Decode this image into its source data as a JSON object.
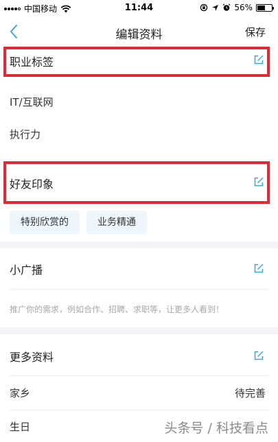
{
  "status_bar": {
    "carrier": "中国移动",
    "time": "11:44",
    "battery_percent": "56%",
    "battery_level": 0.56,
    "icons": [
      "signal-icon",
      "wifi-icon",
      "lock-rotation-icon",
      "location-icon",
      "alarm-icon",
      "battery-icon"
    ]
  },
  "nav": {
    "title": "编辑资料",
    "save_label": "保存",
    "back_icon": "chevron-left-icon"
  },
  "career_tags": {
    "title": "职业标签",
    "items": [
      "IT/互联网",
      "执行力"
    ]
  },
  "friend_impressions": {
    "title": "好友印象",
    "chips": [
      "特别欣赏的",
      "业务精通"
    ]
  },
  "broadcast": {
    "title": "小广播",
    "hint": "推广你的需求，例如合作、招聘、求职等，让更多人看到！"
  },
  "more_info": {
    "title": "更多资料",
    "rows": [
      {
        "label": "家乡",
        "value": "待完善"
      },
      {
        "label": "生日",
        "value": ""
      }
    ]
  },
  "watermark": "头条号 / 科技看点",
  "colors": {
    "accent": "#3aa6d8",
    "highlight": "#e8262f",
    "chip_bg": "#eef6fb",
    "section_gap": "#f4f4f6",
    "hint_text": "#a8a8a8"
  }
}
